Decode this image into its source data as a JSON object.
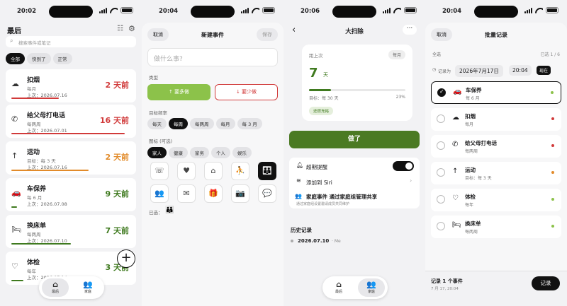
{
  "colors": {
    "red": "#d13a3a",
    "orange": "#e28b2a",
    "green": "#3f7a1f",
    "accent": "#4b7a23",
    "lime": "#8cc24a"
  },
  "screen1": {
    "time": "20:02",
    "title": "最后",
    "search_placeholder": "搜索事件或笔记",
    "filters": [
      "全部",
      "快到了",
      "正常"
    ],
    "cards": [
      {
        "icon": "cloud-icon",
        "glyph": "☁",
        "title": "扣烟",
        "freq": "每月",
        "last": "上次：2026.07.16",
        "ago": "2 天前",
        "color": "#d13a3a",
        "bar": "0.4"
      },
      {
        "icon": "phone-icon",
        "glyph": "✆",
        "title": "给父母打电话",
        "freq": "每两周",
        "last": "上次：2026.07.01",
        "ago": "16 天前",
        "color": "#d13a3a",
        "bar": "0.95"
      },
      {
        "icon": "arrow-up-icon",
        "glyph": "↑",
        "title": "运动",
        "freq": "目标：每 3 天",
        "last": "上次：2026.07.16",
        "ago": "2 天前",
        "color": "#e28b2a",
        "bar": "0.65"
      },
      {
        "icon": "car-icon",
        "glyph": "🚗",
        "title": "车保养",
        "freq": "每 6 月",
        "last": "上次：2026.07.08",
        "ago": "9 天前",
        "color": "#3f7a1f",
        "bar": "0.05"
      },
      {
        "icon": "bed-icon",
        "glyph": "🛏",
        "title": "换床单",
        "freq": "每两周",
        "last": "上次：2026.07.10",
        "ago": "7 天前",
        "color": "#3f7a1f",
        "bar": "0.5"
      },
      {
        "icon": "stethoscope-icon",
        "glyph": "♡",
        "title": "体检",
        "freq": "每年",
        "last": "上次：2026.07.14",
        "ago": "3 天前",
        "color": "#3f7a1f",
        "bar": "0.1"
      }
    ],
    "tabs": [
      {
        "label": "最后",
        "glyph": "⌂"
      },
      {
        "label": "家庭",
        "glyph": "👥"
      }
    ]
  },
  "screen2": {
    "time": "20:04",
    "cancel": "取消",
    "title": "新建事件",
    "save": "保存",
    "name_placeholder": "做什么事?",
    "type_label": "类型",
    "type_more": "↑ 要多做",
    "type_less": "↓ 要少做",
    "freq_label": "目标频率",
    "freqs": [
      "每天",
      "每周",
      "每两周",
      "每月",
      "每 3 月"
    ],
    "icon_label": "图标 (可选)",
    "icon_cats": [
      "家人",
      "健康",
      "家务",
      "个人",
      "娱乐"
    ],
    "icons": [
      "☏",
      "♥",
      "⌂",
      "⛹",
      "👪",
      "👥",
      "✉",
      "🎁",
      "📷",
      "💬"
    ],
    "selected_label": "已选：",
    "selected_glyph": "👪"
  },
  "screen3": {
    "time": "20:06",
    "title": "大扫除",
    "last_label": "距上次",
    "freq": "每月",
    "days": "7",
    "days_unit": "天",
    "progress": 0.23,
    "target": "目标：每 30 天",
    "pct": "23%",
    "status": "还很充裕",
    "done": "做了",
    "reminder": "超期提醒",
    "siri": "添加到 Siri",
    "share_title": "家庭事件 通过家庭组管理共享",
    "share_sub": "通过家庭组设置邀请成员共同维护",
    "history_label": "历史记录",
    "history": [
      {
        "date": "2026.07.10",
        "by": "· Me"
      }
    ],
    "tabs": [
      {
        "label": "最后",
        "glyph": "⌂"
      },
      {
        "label": "家庭",
        "glyph": "👥"
      }
    ]
  },
  "screen4": {
    "time": "20:04",
    "cancel": "取消",
    "title": "批量记录",
    "all_label": "全选",
    "count": "已选 1 / 6",
    "record_as": "记录为",
    "date": "2026年7月17日",
    "clock": "20:04",
    "now": "现在",
    "items": [
      {
        "icon": "car-icon",
        "glyph": "🚗",
        "title": "车保养",
        "freq": "每 6 月",
        "checked": true,
        "color": "#8cc24a"
      },
      {
        "icon": "cloud-icon",
        "glyph": "☁",
        "title": "扣烟",
        "freq": "每月",
        "checked": false,
        "color": "#d13a3a"
      },
      {
        "icon": "phone-icon",
        "glyph": "✆",
        "title": "给父母打电话",
        "freq": "每两周",
        "checked": false,
        "color": "#d13a3a"
      },
      {
        "icon": "arrow-up-icon",
        "glyph": "↑",
        "title": "运动",
        "freq": "目标：每 3 天",
        "checked": false,
        "color": "#e28b2a"
      },
      {
        "icon": "stethoscope-icon",
        "glyph": "♡",
        "title": "体检",
        "freq": "每年",
        "checked": false,
        "color": "#8cc24a"
      },
      {
        "icon": "bed-icon",
        "glyph": "🛏",
        "title": "换床单",
        "freq": "每两周",
        "checked": false,
        "color": "#8cc24a"
      }
    ],
    "footer_title": "记录 1 个事件",
    "footer_sub": "7 月 17, 20:04",
    "record_btn": "记录"
  }
}
